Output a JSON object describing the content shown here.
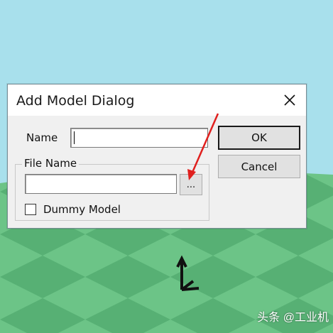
{
  "dialog": {
    "title": "Add Model Dialog",
    "name_label": "Name",
    "name_value": "",
    "file_group_label": "File Name",
    "file_name_value": "",
    "browse_label": "...",
    "dummy_model_label": "Dummy Model",
    "dummy_model_checked": false,
    "ok_label": "OK",
    "cancel_label": "Cancel"
  },
  "watermark": "头条 @工业机",
  "colors": {
    "sky": "#a8e0ec",
    "ground_light": "#6cc487",
    "ground_dark": "#52ab70",
    "annotation_arrow": "#e0201e"
  },
  "icons": [
    "close-icon",
    "annotation-arrow",
    "axis-gizmo-icon"
  ]
}
